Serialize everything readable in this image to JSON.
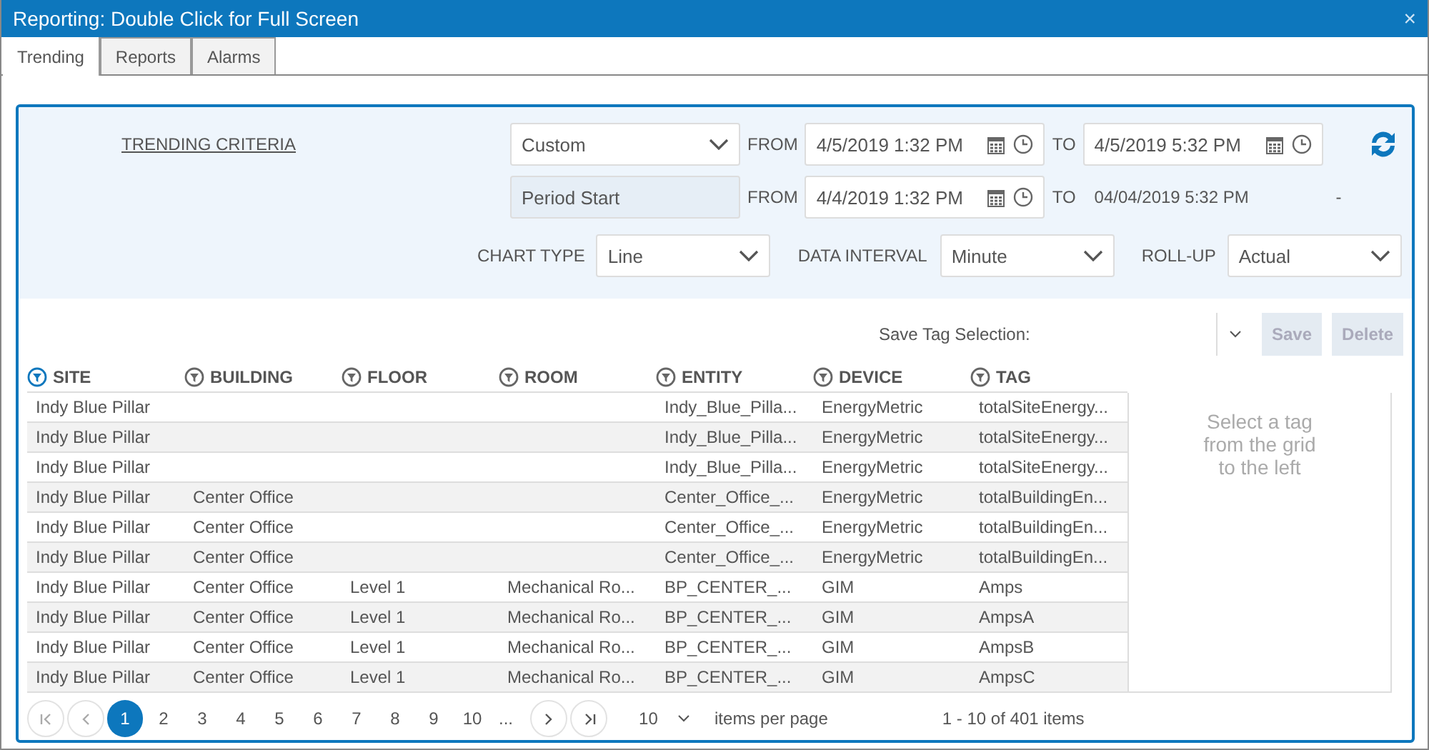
{
  "window": {
    "title": "Reporting: Double Click for Full Screen",
    "close": "×"
  },
  "tabs": [
    {
      "label": "Trending",
      "selected": true
    },
    {
      "label": "Reports",
      "selected": false
    },
    {
      "label": "Alarms",
      "selected": false
    }
  ],
  "criteria": {
    "heading": "TRENDING CRITERIA",
    "period": "Custom",
    "from_label": "FROM",
    "from": "4/5/2019 1:32 PM",
    "to_label": "TO",
    "to": "4/5/2019 5:32 PM",
    "compare": {
      "value": "Period Start",
      "disabled": true
    },
    "compare_from_label": "FROM",
    "compare_from": "4/4/2019 1:32 PM",
    "compare_to_label": "TO",
    "compare_to": "04/04/2019 5:32 PM",
    "compare_dash": "-",
    "chart_type_label": "CHART TYPE",
    "chart_type": "Line",
    "interval_label": "DATA INTERVAL",
    "interval": "Minute",
    "rollup_label": "ROLL-UP",
    "rollup": "Actual"
  },
  "tag_selection": {
    "label": "Save Tag Selection:",
    "buttons": [
      {
        "label": "Save",
        "disabled": true
      },
      {
        "label": "Delete",
        "disabled": true
      }
    ]
  },
  "table": {
    "columns": [
      {
        "label": "SITE",
        "filtered": true
      },
      {
        "label": "BUILDING",
        "filtered": false
      },
      {
        "label": "FLOOR",
        "filtered": false
      },
      {
        "label": "ROOM",
        "filtered": false
      },
      {
        "label": "ENTITY",
        "filtered": false
      },
      {
        "label": "DEVICE",
        "filtered": false
      },
      {
        "label": "TAG",
        "filtered": false
      }
    ],
    "rows": [
      [
        "Indy Blue Pillar",
        "",
        "",
        "",
        "Indy_Blue_Pilla...",
        "EnergyMetric",
        "totalSiteEnergy..."
      ],
      [
        "Indy Blue Pillar",
        "",
        "",
        "",
        "Indy_Blue_Pilla...",
        "EnergyMetric",
        "totalSiteEnergy..."
      ],
      [
        "Indy Blue Pillar",
        "",
        "",
        "",
        "Indy_Blue_Pilla...",
        "EnergyMetric",
        "totalSiteEnergy..."
      ],
      [
        "Indy Blue Pillar",
        "Center Office",
        "",
        "",
        "Center_Office_...",
        "EnergyMetric",
        "totalBuildingEn..."
      ],
      [
        "Indy Blue Pillar",
        "Center Office",
        "",
        "",
        "Center_Office_...",
        "EnergyMetric",
        "totalBuildingEn..."
      ],
      [
        "Indy Blue Pillar",
        "Center Office",
        "",
        "",
        "Center_Office_...",
        "EnergyMetric",
        "totalBuildingEn..."
      ],
      [
        "Indy Blue Pillar",
        "Center Office",
        "Level 1",
        "Mechanical Ro...",
        "BP_CENTER_...",
        "GIM",
        "Amps"
      ],
      [
        "Indy Blue Pillar",
        "Center Office",
        "Level 1",
        "Mechanical Ro...",
        "BP_CENTER_...",
        "GIM",
        "AmpsA"
      ],
      [
        "Indy Blue Pillar",
        "Center Office",
        "Level 1",
        "Mechanical Ro...",
        "BP_CENTER_...",
        "GIM",
        "AmpsB"
      ],
      [
        "Indy Blue Pillar",
        "Center Office",
        "Level 1",
        "Mechanical Ro...",
        "BP_CENTER_...",
        "GIM",
        "AmpsC"
      ]
    ]
  },
  "side_panel": {
    "message": "Select a tag from the grid to the left"
  },
  "pager": {
    "pages": [
      {
        "label": "1",
        "selected": true
      },
      {
        "label": "2",
        "selected": false
      },
      {
        "label": "3",
        "selected": false
      },
      {
        "label": "4",
        "selected": false
      },
      {
        "label": "5",
        "selected": false
      },
      {
        "label": "6",
        "selected": false
      },
      {
        "label": "7",
        "selected": false
      },
      {
        "label": "8",
        "selected": false
      },
      {
        "label": "9",
        "selected": false
      },
      {
        "label": "10",
        "selected": false
      }
    ],
    "more": "...",
    "page_size": "10",
    "page_size_label": "items per page",
    "summary": "1 - 10 of 401 items"
  }
}
